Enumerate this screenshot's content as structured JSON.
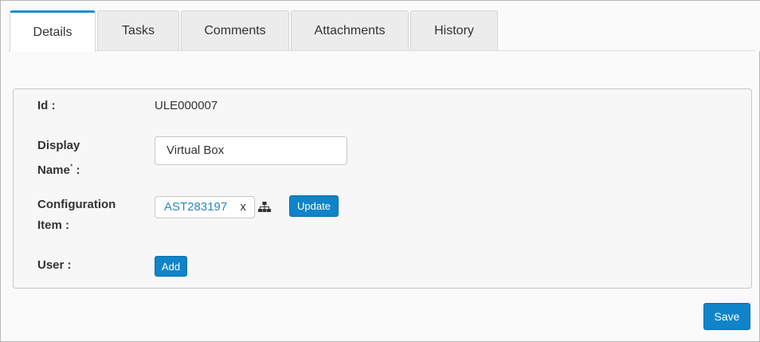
{
  "tabs": [
    {
      "label": "Details"
    },
    {
      "label": "Tasks"
    },
    {
      "label": "Comments"
    },
    {
      "label": "Attachments"
    },
    {
      "label": "History"
    }
  ],
  "form": {
    "id_label": "Id :",
    "id_value": "ULE000007",
    "display_name_label_line1": "Display",
    "display_name_label_line2": "Name",
    "display_name_required_marker": "*",
    "display_name_label_suffix": " :",
    "display_name_value": "Virtual Box",
    "config_item_label_line1": "Configuration",
    "config_item_label_line2": "Item :",
    "config_item_tag": "AST283197",
    "config_item_remove": "x",
    "update_label": "Update",
    "user_label": "User :",
    "add_label": "Add"
  },
  "actions": {
    "save_label": "Save"
  },
  "colors": {
    "accent": "#0f84c8",
    "active_tab_border": "#1f8ed0",
    "link": "#2a86c4"
  },
  "icons": {
    "hierarchy": "hierarchy-icon"
  }
}
